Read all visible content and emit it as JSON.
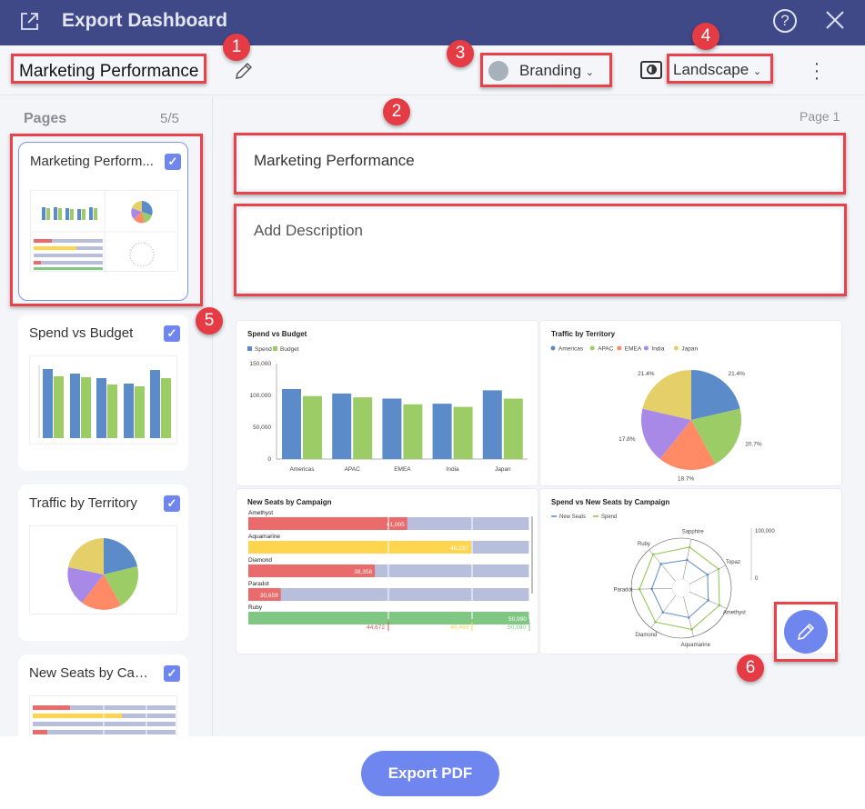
{
  "titlebar": {
    "title": "Export Dashboard",
    "help_label": "?",
    "icons": [
      "export-icon",
      "help-icon",
      "close-icon"
    ]
  },
  "toolbar": {
    "dashboard_name": "Marketing Performance",
    "branding_label": "Branding",
    "orientation_label": "Landscape",
    "branding_color": "#a6b1ba"
  },
  "annotations": [
    "1",
    "2",
    "3",
    "4",
    "5",
    "6"
  ],
  "sidebar": {
    "header": "Pages",
    "count": "5/5",
    "pages": [
      {
        "name": "Marketing Perform...",
        "checked": true,
        "selected": true
      },
      {
        "name": "Spend vs Budget",
        "checked": true,
        "selected": false
      },
      {
        "name": "Traffic by Territory",
        "checked": true,
        "selected": false
      },
      {
        "name": "New Seats by Cam...",
        "checked": true,
        "selected": false
      }
    ]
  },
  "main": {
    "page_label": "Page 1",
    "title_value": "Marketing Performance",
    "description_placeholder": "Add Description"
  },
  "footer": {
    "export_label": "Export PDF"
  },
  "colors": {
    "accent": "#6f86ef",
    "titlebar": "#3f4987",
    "annotation": "#e53b44"
  },
  "chart_data": [
    {
      "type": "bar",
      "title": "Spend vs Budget",
      "categories": [
        "Americas",
        "APAC",
        "EMEA",
        "India",
        "Japan"
      ],
      "series": [
        {
          "name": "Spend",
          "color": "#5b8bc9",
          "values": [
            110000,
            103000,
            95000,
            87000,
            108000
          ]
        },
        {
          "name": "Budget",
          "color": "#9ccc65",
          "values": [
            99000,
            97000,
            86000,
            82000,
            95000
          ]
        }
      ],
      "yticks": [
        "150,000",
        "100,000",
        "50,000",
        "0"
      ],
      "ylim": [
        0,
        150000
      ],
      "legend": "top-left"
    },
    {
      "type": "pie",
      "title": "Traffic by Territory",
      "labels": [
        "Americas",
        "APAC",
        "EMEA",
        "India",
        "Japan"
      ],
      "values": [
        21.4,
        20.7,
        18.7,
        17.8,
        21.4
      ],
      "value_labels": [
        "21.4%",
        "20.7%",
        "18.7%",
        "17.8%",
        "21.4%"
      ],
      "colors": [
        "#5b8bc9",
        "#9ccc65",
        "#ff8a65",
        "#a889e8",
        "#e4cf68"
      ],
      "legend": "top-left"
    },
    {
      "type": "bar",
      "title": "New Seats by Campaign",
      "orientation": "horizontal-bullet",
      "categories": [
        "Amethyst",
        "Aquamarine",
        "Diamond",
        "Paradot",
        "Ruby"
      ],
      "values": [
        41005,
        46237,
        38358,
        30659,
        50990
      ],
      "value_labels": [
        "41,005",
        "46,237",
        "38,358",
        "30,659",
        "50,990"
      ],
      "bar_colors": [
        "#ea6b6b",
        "#ffd54f",
        "#ea6b6b",
        "#ea6b6b",
        "#81c784"
      ],
      "ranges": [
        "44,672",
        "46,469",
        "50,990"
      ],
      "range_colors": [
        "#e55353",
        "#ffd54f",
        "#81c784"
      ],
      "xlim": [
        28000,
        51000
      ]
    },
    {
      "type": "radar",
      "title": "Spend vs New Seats by Campaign",
      "axes": [
        "Sapphire",
        "Topaz",
        "Amethyst",
        "Aquamarine",
        "Diamond",
        "Paradot",
        "Ruby"
      ],
      "series": [
        {
          "name": "New Seats",
          "color": "#5b8bc9",
          "values": [
            48000,
            50000,
            50000,
            52000,
            52000,
            50000,
            55000
          ]
        },
        {
          "name": "Spend",
          "color": "#8bc34a",
          "values": [
            80000,
            80000,
            80000,
            82000,
            82000,
            80000,
            85000
          ]
        }
      ],
      "scale_labels": [
        "100,000",
        "0"
      ],
      "rlim": [
        0,
        100000
      ]
    }
  ]
}
